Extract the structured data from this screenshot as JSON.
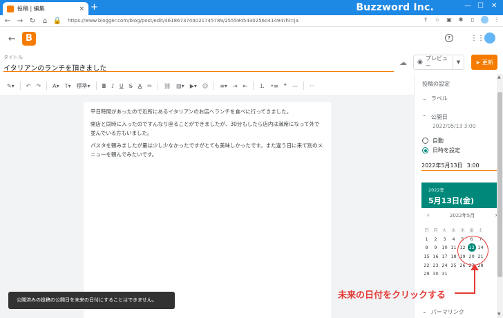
{
  "browser": {
    "tab_title": "投稿 | 編集",
    "tab_close": "×",
    "new_tab": "+",
    "url": "https://www.blogger.com/blog/post/edit/4618673744021745789/2555945430256041494?hl=ja",
    "brand": "Buzzword Inc.",
    "win_min": "—",
    "win_max": "☐",
    "win_close": "✕"
  },
  "header": {
    "logo": "B",
    "help": "?"
  },
  "post": {
    "title_label": "タイトル",
    "title": "イタリアンのランチを頂きました",
    "paragraphs": [
      "平日時間があったので近所にあるイタリアンのお店へランチを食べに行ってきました。",
      "開店と同時に入ったのですんなり座ることができましたが、30分もしたら店内は満席になって外で並んでいる方もいました。",
      "パスタを頼みましたが量は少し少なかったですがとても美味しかったです。また違う日に来て別のメニューを頼んでみたいです。"
    ]
  },
  "actions": {
    "preview": "プレビュー",
    "update": "更新"
  },
  "toolbar": {
    "style": "標準",
    "bold": "B",
    "italic": "I",
    "underline": "U",
    "strike": "S",
    "textcolor": "A",
    "quote": "❞",
    "more": "···"
  },
  "toast": "公開済みの投稿の公開日を未来の日付にすることはできません。",
  "panel": {
    "title": "投稿の設定",
    "labels": "ラベル",
    "publish": "公開日",
    "publish_value": "2022/05/13 3:00",
    "auto": "自動",
    "set_datetime": "日時を設定",
    "date": "2022年5月13日",
    "time": "3:00",
    "permalink": "パーマリンク"
  },
  "calendar": {
    "year": "2022年",
    "selected": "5月13日(金)",
    "month": "2022年5月",
    "weekdays": [
      "日",
      "月",
      "火",
      "水",
      "木",
      "金",
      "土"
    ],
    "weeks": [
      [
        "1",
        "2",
        "3",
        "4",
        "5",
        "6",
        "7"
      ],
      [
        "8",
        "9",
        "10",
        "11",
        "12",
        "13",
        "14"
      ],
      [
        "15",
        "16",
        "17",
        "18",
        "19",
        "20",
        "21"
      ],
      [
        "22",
        "23",
        "24",
        "25",
        "26",
        "27",
        "28"
      ],
      [
        "29",
        "30",
        "31",
        "",
        "",
        "",
        ""
      ]
    ],
    "selected_day": "13"
  },
  "annotation": "未来の日付をクリックする",
  "colors": {
    "accent": "#f57c00",
    "calendar": "#00897b",
    "annotation": "#e53935",
    "chrome": "#1e88e5"
  }
}
